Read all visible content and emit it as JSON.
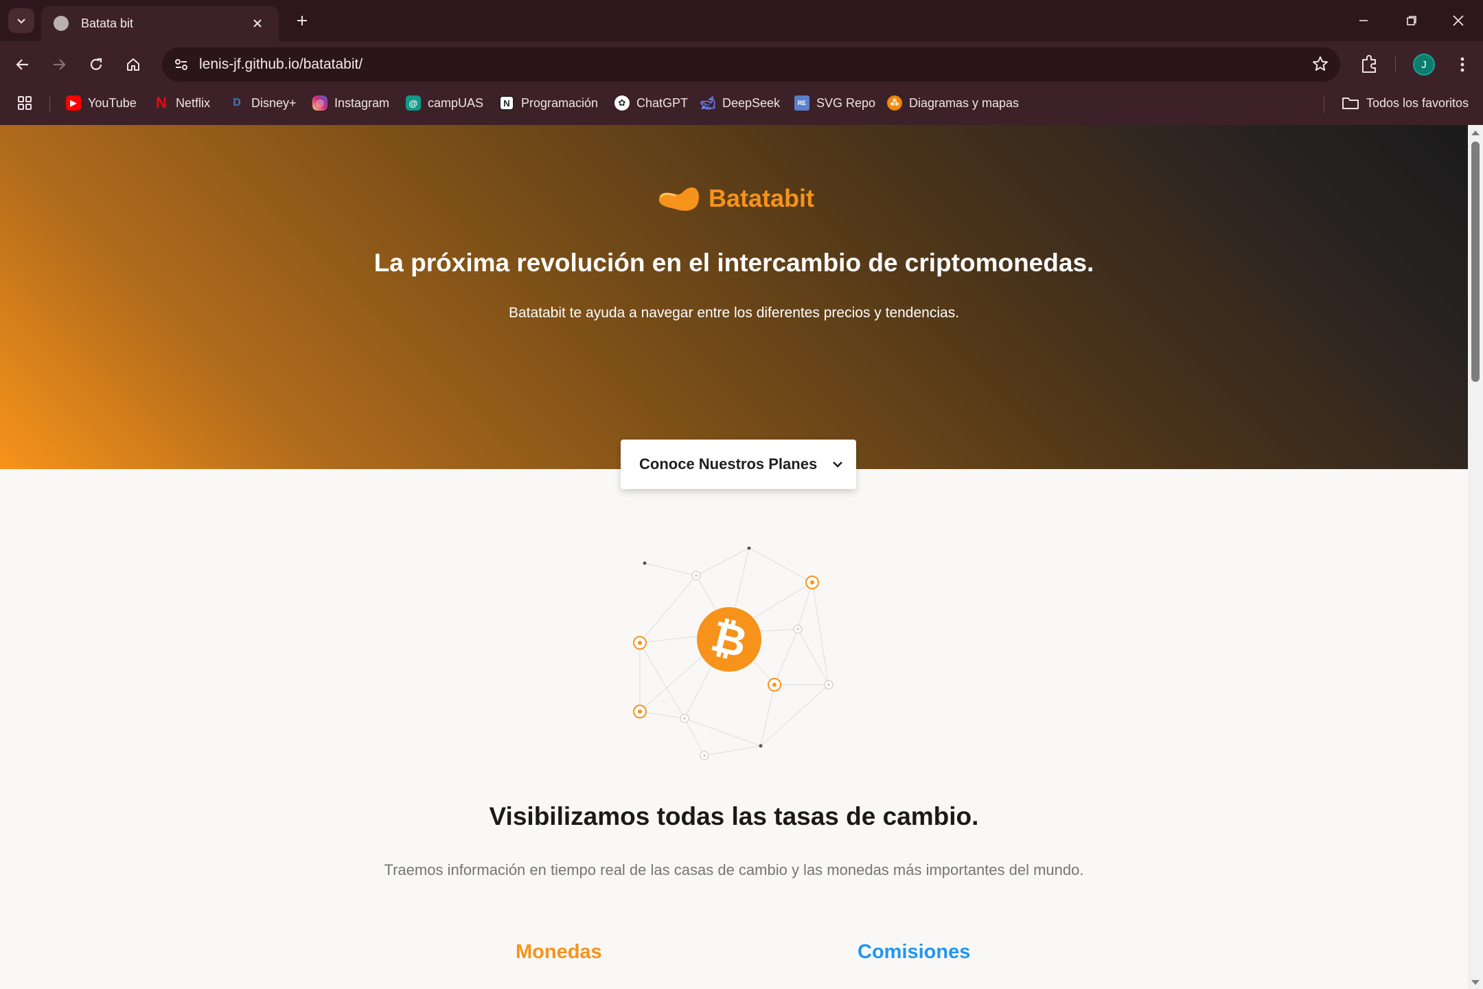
{
  "browser": {
    "tab_title": "Batata bit",
    "url": "lenis-jf.github.io/batatabit/",
    "profile_initial": "J",
    "bookmarks": [
      {
        "label": "YouTube",
        "icon": "youtube-icon",
        "color": "#ff0000"
      },
      {
        "label": "Netflix",
        "icon": "netflix-icon",
        "color": "#e50914"
      },
      {
        "label": "Disney+",
        "icon": "disney-icon",
        "color": "#1a5c8f"
      },
      {
        "label": "Instagram",
        "icon": "instagram-icon",
        "color": "#d62976"
      },
      {
        "label": "campUAS",
        "icon": "campuas-icon",
        "color": "#12998a"
      },
      {
        "label": "Programación",
        "icon": "notion-icon",
        "color": "#222222"
      },
      {
        "label": "ChatGPT",
        "icon": "chatgpt-icon",
        "color": "#2b2b2b"
      },
      {
        "label": "DeepSeek",
        "icon": "deepseek-icon",
        "color": "#4d6bfe"
      },
      {
        "label": "SVG Repo",
        "icon": "svgrepo-icon",
        "color": "#5b7fc8"
      },
      {
        "label": "Diagramas y mapas",
        "icon": "diagrams-icon",
        "color": "#f08705"
      }
    ],
    "all_bookmarks_label": "Todos los favoritos"
  },
  "hero": {
    "logo_text": "Batatabit",
    "title": "La próxima revolución en el intercambio de criptomonedas.",
    "subtitle": "Batatabit te ayuda a navegar entre los diferentes precios y tendencias.",
    "plans_button": "Conoce Nuestros Planes"
  },
  "section": {
    "title": "Visibilizamos todas las tasas de cambio.",
    "subtitle": "Traemos información en tiempo real de las casas de cambio y las monedas más importantes del mundo.",
    "tab_coins": "Monedas",
    "tab_commissions": "Comisiones"
  },
  "colors": {
    "accent_orange": "#f7931a",
    "accent_blue": "#2196f3",
    "chrome_bg": "#3d2128"
  }
}
